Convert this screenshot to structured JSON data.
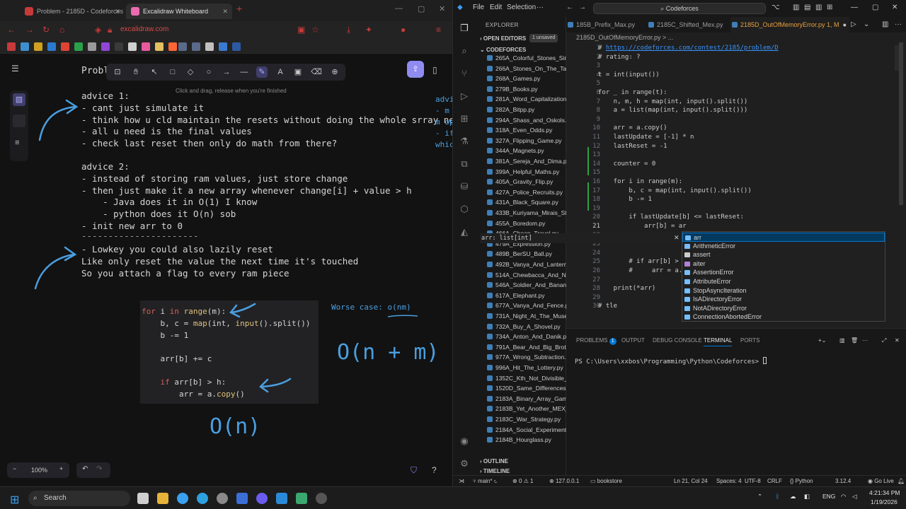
{
  "browser": {
    "tabs": [
      {
        "title": "Problem - 2185D - Codeforces"
      },
      {
        "title": "Excalidraw Whiteboard"
      }
    ],
    "url": "excalidraw.com",
    "exc_hint": "Click and drag, release when you're finished",
    "problem_heading": "Proble",
    "zoom": "100%",
    "accent": "#8f8bf1"
  },
  "board": {
    "advice1": [
      "advice 1:",
      "- cant just simulate it",
      "- think how u cld maintain the resets without doing the whole srray new",
      "- all u need is the final values",
      "- check last reset then only do math from there?"
    ],
    "advice2": [
      "advice 2:",
      "- instead of storing ram values, just store change",
      "- then just make it a new array whenever change[i] + value > h",
      "    - Java does it in O(1) I know",
      "    - python does it O(n) sob",
      "- init new arr to 0",
      "----------------------",
      "- Lowkey you could also lazily reset",
      "Like only reset the value the next time it's touched",
      "So you attach a flag to every ram piece"
    ],
    "right_partial": [
      "advi",
      "- m",
      "m op",
      "- if",
      "whic"
    ],
    "code": [
      "for i in range(m):",
      "    b, c = map(int, input().split())",
      "    b -= 1",
      "",
      "    arr[b] += c",
      "",
      "    if arr[b] > h:",
      "        arr = a.copy()"
    ],
    "worst_case": "Worse case: o(nm)",
    "big_o_nm": "O(n + m)",
    "big_o_n": "O(n)"
  },
  "vscode": {
    "menu": [
      "File",
      "Edit",
      "Selection"
    ],
    "search": "Codeforces",
    "explorer_title": "EXPLORER",
    "open_editors": "OPEN EDITORS",
    "unsaved": "1 unsaved",
    "folder": "CODEFORCES",
    "files": [
      "265A_Colorful_Stones_Sim...",
      "266A_Stones_On_The_Tabl...",
      "268A_Games.py",
      "279B_Books.py",
      "281A_Word_Capitalization...",
      "282A_Bitpp.py",
      "294A_Shass_and_Oskols.py",
      "318A_Even_Odds.py",
      "327A_Flipping_Game.py",
      "344A_Magnets.py",
      "381A_Sereja_And_Dima.py",
      "399A_Helpful_Maths.py",
      "405A_Gravity_Flip.py",
      "427A_Police_Recruits.py",
      "431A_Black_Square.py",
      "433B_Kuriyama_Mirais_Sto...",
      "455A_Boredom.py",
      "466A_Cheap_Travel.py",
      "479A_Expression.py",
      "489B_BerSU_Ball.py",
      "492B_Vanya_And_Lanterns...",
      "514A_Chewbacca_And_Nu...",
      "546A_Soldier_And_Banana...",
      "617A_Elephant.py",
      "677A_Vanya_And_Fence.py",
      "731A_Night_At_The_Muse...",
      "732A_Buy_A_Shovel.py",
      "734A_Anton_And_Danik.py",
      "791A_Bear_And_Big_Broth...",
      "977A_Wrong_Subtraction...",
      "996A_Hit_The_Lottery.py",
      "1352C_Kth_Not_Divisible_...",
      "1520D_Same_Differences.py",
      "2183A_Binary_Array_Gam...",
      "2183B_Yet_Another_MEX_...",
      "2183C_War_Strategy.py",
      "2184A_Social_Experiment...",
      "2184B_Hourglass.py"
    ],
    "outline": "OUTLINE",
    "timeline": "TIMELINE",
    "tabs": [
      "185B_Prefix_Max.py",
      "2185C_Shifted_Mex.py",
      "2185D_OutOfMemoryError.py 1, M"
    ],
    "breadcrumb": "2185D_OutOfMemoryError.py > ...",
    "code_lines": [
      {
        "n": "1",
        "t": "# https://codeforces.com/contest/2185/problem/D"
      },
      {
        "n": "2",
        "t": "# rating: ?"
      },
      {
        "n": "3",
        "t": ""
      },
      {
        "n": "4",
        "t": "t = int(input())"
      },
      {
        "n": "5",
        "t": ""
      },
      {
        "n": "6",
        "t": "for _ in range(t):"
      },
      {
        "n": "7",
        "t": "    n, m, h = map(int, input().split())"
      },
      {
        "n": "8",
        "t": "    a = list(map(int, input().split()))"
      },
      {
        "n": "9",
        "t": ""
      },
      {
        "n": "10",
        "t": "    arr = a.copy()"
      },
      {
        "n": "11",
        "t": "    lastUpdate = [-1] * n"
      },
      {
        "n": "12",
        "t": "    lastReset = -1"
      },
      {
        "n": "13",
        "t": ""
      },
      {
        "n": "14",
        "t": "    counter = 0"
      },
      {
        "n": "15",
        "t": ""
      },
      {
        "n": "16",
        "t": "    for i in range(m):"
      },
      {
        "n": "17",
        "t": "        b, c = map(int, input().split())"
      },
      {
        "n": "18",
        "t": "        b -= 1"
      },
      {
        "n": "19",
        "t": ""
      },
      {
        "n": "20",
        "t": "        if lastUpdate[b] <= lastReset:"
      },
      {
        "n": "21",
        "t": "            arr[b] = ar"
      },
      {
        "n": "22",
        "t": ""
      },
      {
        "n": "23",
        "t": ""
      },
      {
        "n": "24",
        "t": ""
      },
      {
        "n": "25",
        "t": "        # if arr[b] > h"
      },
      {
        "n": "26",
        "t": "        #     arr = a.c"
      },
      {
        "n": "27",
        "t": ""
      },
      {
        "n": "28",
        "t": "    print(*arr)"
      },
      {
        "n": "29",
        "t": ""
      },
      {
        "n": "30",
        "t": "# tle"
      }
    ],
    "hover_detail": "arr: list[int]",
    "suggestions": [
      "arr",
      "ArithmeticError",
      "assert",
      "aiter",
      "AssertionError",
      "AttributeError",
      "StopAsyncIteration",
      "IsADirectoryError",
      "NotADirectoryError",
      "ConnectionAbortedError"
    ],
    "panel_tabs": [
      "PROBLEMS",
      "OUTPUT",
      "DEBUG CONSOLE",
      "TERMINAL",
      "PORTS"
    ],
    "problems_count": "1",
    "terminal_prompt": "PS C:\\Users\\xxbos\\Programming\\Python\\Codeforces>",
    "status": {
      "branch": "main*",
      "errors": "0",
      "warnings": "1",
      "host": "127.0.0.1",
      "bookstore": "bookstore",
      "position": "Ln 21, Col 24",
      "spaces": "Spaces: 4",
      "encoding": "UTF-8",
      "eol": "CRLF",
      "language": "Python",
      "version": "3.12.4",
      "golive": "Go Live"
    }
  },
  "taskbar": {
    "search": "Search",
    "lang": "ENG",
    "time": "4:21:34 PM",
    "date": "1/19/2026"
  }
}
